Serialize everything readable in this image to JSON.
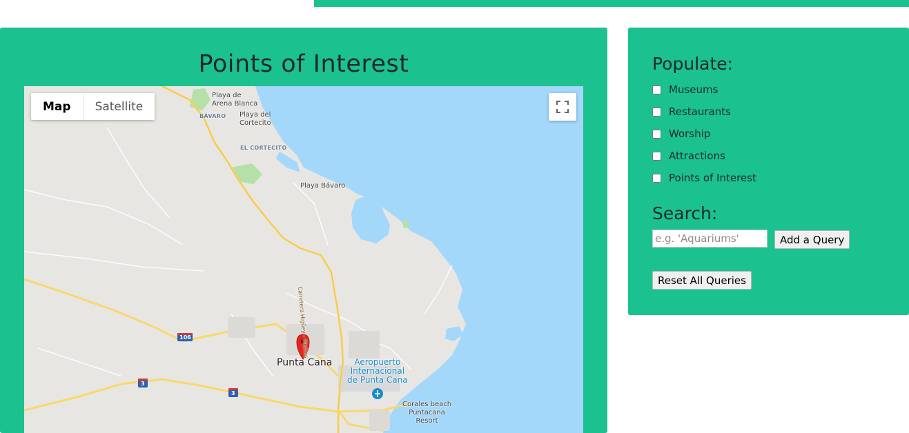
{
  "title": "Points of Interest",
  "map": {
    "type_map": "Map",
    "type_satellite": "Satellite",
    "labels": {
      "playa_arena_blanca": "Playa de\nArena Blanca",
      "bavaro": "BÁVARO",
      "playa_cortecito": "Playa del\nCortecito",
      "el_cortecito": "EL CORTECITO",
      "playa_bavaro": "Playa Bávaro",
      "carretera": "Carretera Higüey - Miches",
      "punta_cana": "Punta Cana",
      "airport": "Aeropuerto\nInternacional\nde Punta Cana",
      "corales": "Corales beach\nPuntacana\nResort",
      "shield_106": "106",
      "shield_3a": "3",
      "shield_3b": "3"
    }
  },
  "populate": {
    "heading": "Populate:",
    "options": [
      "Museums",
      "Restaurants",
      "Worship",
      "Attractions",
      "Points of Interest"
    ]
  },
  "search": {
    "heading": "Search:",
    "placeholder": "e.g. 'Aquariums'",
    "add_label": "Add a Query",
    "reset_label": "Reset All Queries"
  },
  "colors": {
    "accent": "#1bc18e",
    "water": "#a3d8fb",
    "land": "#e8e6e3",
    "highway": "#f9d86b",
    "park": "#b5e0a8",
    "marker": "#e8231d"
  }
}
